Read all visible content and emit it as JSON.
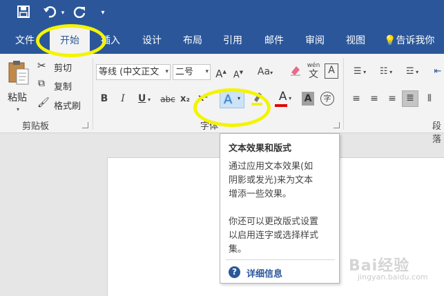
{
  "quick_access": {
    "save_icon": "save-icon",
    "undo_icon": "undo-icon",
    "redo_icon": "redo-icon",
    "customize_icon": "customize-icon"
  },
  "tabs": [
    {
      "label": "文件"
    },
    {
      "label": "开始"
    },
    {
      "label": "插入"
    },
    {
      "label": "设计"
    },
    {
      "label": "布局"
    },
    {
      "label": "引用"
    },
    {
      "label": "邮件"
    },
    {
      "label": "审阅"
    },
    {
      "label": "视图"
    }
  ],
  "tell_me": "告诉我你",
  "clipboard": {
    "paste": "粘贴",
    "cut": "剪切",
    "copy": "复制",
    "format_painter": "格式刷",
    "group_label": "剪贴板"
  },
  "font": {
    "font_name": "等线 (中文正文",
    "font_size": "二号",
    "grow": "A",
    "shrink": "A",
    "change_case": "Aa",
    "phonetic": "wén",
    "border_char": "A",
    "bold": "B",
    "italic": "I",
    "underline": "U",
    "strikethrough": "abc",
    "subscript": "x₂",
    "superscript": "x²",
    "text_effects": "A",
    "font_color": "A",
    "char_shading": "A",
    "enclose": "字",
    "group_label": "字体"
  },
  "paragraph": {
    "group_label": "段落"
  },
  "tooltip": {
    "title": "文本效果和版式",
    "lines": [
      "通过应用文本效果(如",
      "阴影或发光)来为文本",
      "增添一些效果。",
      "",
      "你还可以更改版式设置",
      "以启用连字或选择样式",
      "集。"
    ],
    "help_icon": "?",
    "help_label": "详细信息"
  },
  "watermark": {
    "text": "Bai经验",
    "sub": "jingyan.baidu.com"
  },
  "colors": {
    "accent": "#2b579a",
    "highlight": "#f4f400",
    "font_color_bar": "#e00000",
    "highlighter_bar": "#f4f400"
  }
}
